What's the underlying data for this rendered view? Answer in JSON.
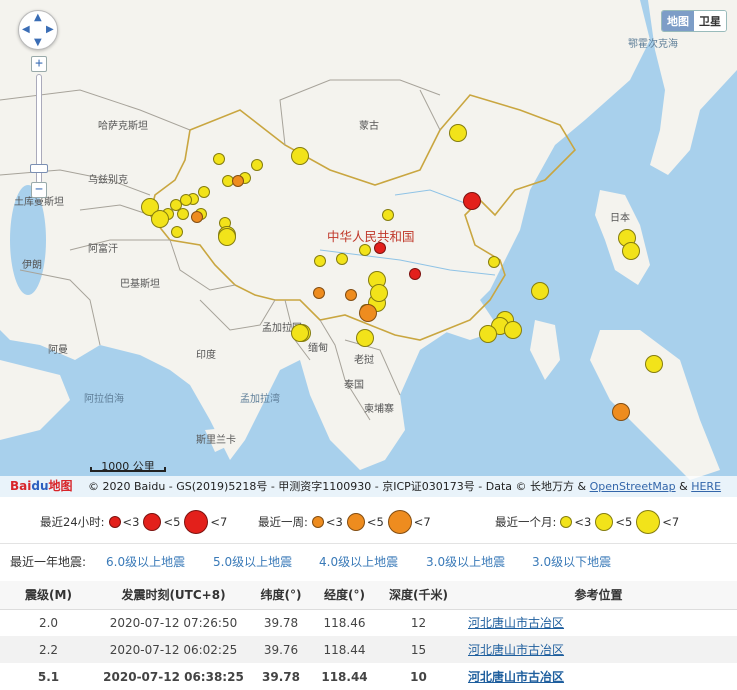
{
  "map": {
    "map_type": {
      "map": "地图",
      "satellite": "卫星"
    },
    "labels": {
      "okhotsk": "鄂霍次克海",
      "kazakhstan": "哈萨克斯坦",
      "mongolia": "蒙古",
      "uzbekistan": "乌兹别克",
      "turkmenistan": "土库曼斯坦",
      "afghanistan": "阿富汗",
      "iran": "伊朗",
      "pakistan": "巴基斯坦",
      "china": "中华人民共和国",
      "japan": "日本",
      "bangladesh": "孟加拉国",
      "myanmar": "缅甸",
      "india": "印度",
      "oman": "阿曼",
      "laos": "老挝",
      "thailand": "泰国",
      "cambodia": "柬埔寨",
      "arabian_sea": "阿拉伯海",
      "bay_of_bengal": "孟加拉湾",
      "sri_lanka": "斯里兰卡"
    },
    "scale_label": "1000 公里",
    "logo_text": "Bai",
    "logo_paw": "du",
    "logo_map": "地图",
    "copyright": "© 2020 Baidu - GS(2019)5218号 - 甲测资字1100930 - 京ICP证030173号 - Data © 长地万方 & ",
    "copyright_osm": "OpenStreetMap",
    "copyright_amp": " & ",
    "copyright_here": "HERE",
    "colors": {
      "red": "#e3201b",
      "orange": "#ee8c1f",
      "yellow": "#f2e31a",
      "water": "#a8d0ec",
      "land": "#f4f3ee"
    },
    "quakes": [
      {
        "color": "yellow",
        "size": "m"
      },
      {
        "color": "yellow",
        "size": "m"
      },
      {
        "color": "yellow",
        "size": "s"
      },
      {
        "color": "yellow",
        "size": "s"
      },
      {
        "color": "yellow",
        "size": "s"
      },
      {
        "color": "yellow",
        "size": "s"
      },
      {
        "color": "orange",
        "size": "s"
      },
      {
        "color": "yellow",
        "size": "s"
      },
      {
        "color": "yellow",
        "size": "s"
      },
      {
        "color": "yellow",
        "size": "m"
      },
      {
        "color": "yellow",
        "size": "s"
      },
      {
        "color": "yellow",
        "size": "s"
      },
      {
        "color": "yellow",
        "size": "s"
      },
      {
        "color": "yellow",
        "size": "m"
      },
      {
        "color": "yellow",
        "size": "s"
      },
      {
        "color": "yellow",
        "size": "s"
      },
      {
        "color": "orange",
        "size": "s"
      },
      {
        "color": "yellow",
        "size": "s"
      },
      {
        "color": "yellow",
        "size": "m"
      },
      {
        "color": "yellow",
        "size": "m"
      },
      {
        "color": "yellow",
        "size": "s"
      },
      {
        "color": "red",
        "size": "m"
      },
      {
        "color": "red",
        "size": "s"
      },
      {
        "color": "yellow",
        "size": "s"
      },
      {
        "color": "yellow",
        "size": "s"
      },
      {
        "color": "yellow",
        "size": "s"
      },
      {
        "color": "red",
        "size": "s"
      },
      {
        "color": "yellow",
        "size": "s"
      },
      {
        "color": "yellow",
        "size": "m"
      },
      {
        "color": "orange",
        "size": "s"
      },
      {
        "color": "orange",
        "size": "s"
      },
      {
        "color": "yellow",
        "size": "m"
      },
      {
        "color": "yellow",
        "size": "m"
      },
      {
        "color": "yellow",
        "size": "s"
      },
      {
        "color": "orange",
        "size": "m"
      },
      {
        "color": "yellow",
        "size": "m"
      },
      {
        "color": "yellow",
        "size": "m"
      },
      {
        "color": "yellow",
        "size": "m"
      },
      {
        "color": "yellow",
        "size": "m"
      },
      {
        "color": "yellow",
        "size": "m"
      },
      {
        "color": "yellow",
        "size": "m"
      },
      {
        "color": "yellow",
        "size": "s"
      },
      {
        "color": "yellow",
        "size": "m"
      },
      {
        "color": "yellow",
        "size": "m"
      },
      {
        "color": "yellow",
        "size": "m"
      },
      {
        "color": "yellow",
        "size": "m"
      },
      {
        "color": "orange",
        "size": "m"
      },
      {
        "color": "yellow",
        "size": "m"
      }
    ]
  },
  "legend": {
    "day": {
      "label": "最近24小时:",
      "items": [
        "<3",
        "<5",
        "<7"
      ]
    },
    "week": {
      "label": "最近一周:",
      "items": [
        "<3",
        "<5",
        "<7"
      ]
    },
    "month": {
      "label": "最近一个月:",
      "items": [
        "<3",
        "<5",
        "<7"
      ]
    }
  },
  "filters": {
    "label": "最近一年地震:",
    "links": [
      "6.0级以上地震",
      "5.0级以上地震",
      "4.0级以上地震",
      "3.0级以上地震",
      "3.0级以下地震"
    ]
  },
  "table": {
    "headers": [
      "震级(M)",
      "发震时刻(UTC+8)",
      "纬度(°)",
      "经度(°)",
      "深度(千米)",
      "参考位置"
    ],
    "rows": [
      {
        "mag": "2.0",
        "time": "2020-07-12 07:26:50",
        "lat": "39.78",
        "lon": "118.46",
        "depth": "12",
        "loc": "河北唐山市古冶区"
      },
      {
        "mag": "2.2",
        "time": "2020-07-12 06:02:25",
        "lat": "39.76",
        "lon": "118.44",
        "depth": "15",
        "loc": "河北唐山市古冶区"
      },
      {
        "mag": "5.1",
        "time": "2020-07-12 06:38:25",
        "lat": "39.78",
        "lon": "118.44",
        "depth": "10",
        "loc": "河北唐山市古冶区"
      }
    ]
  }
}
